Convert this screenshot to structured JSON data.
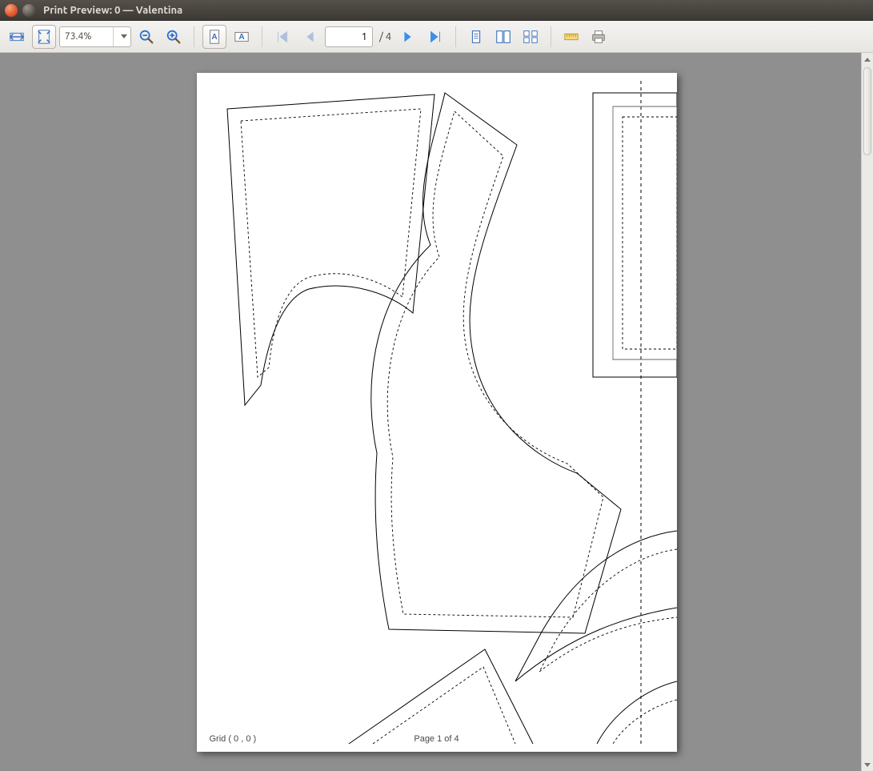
{
  "window": {
    "title": "Print Preview: 0 — Valentina"
  },
  "toolbar": {
    "zoom_value": "73.4%",
    "current_page": "1",
    "total_pages": "/ 4"
  },
  "page": {
    "grid_label": "Grid ( 0 , 0 )",
    "page_label": "Page 1 of 4"
  }
}
